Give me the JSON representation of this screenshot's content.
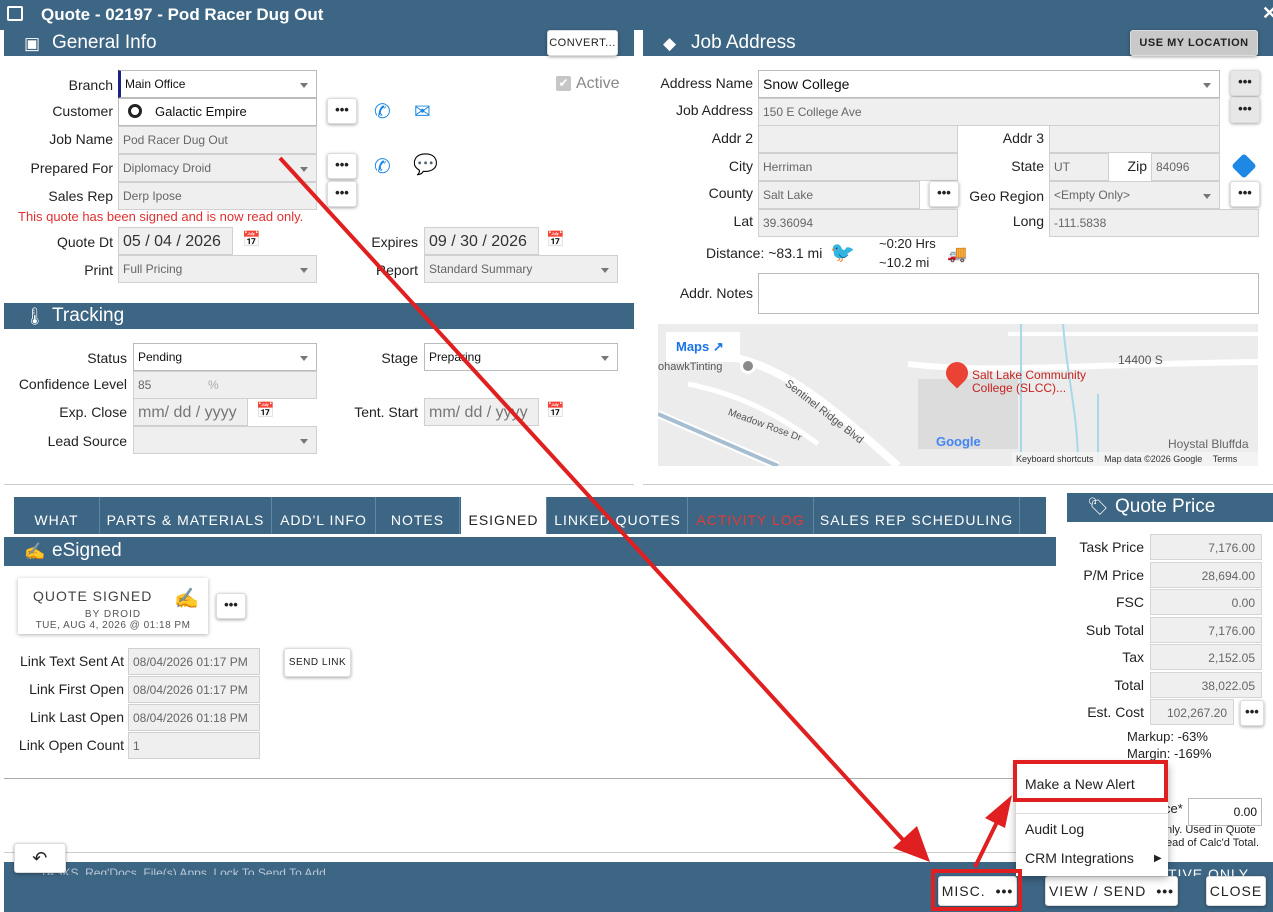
{
  "title": "Quote - 02197 - Pod Racer Dug Out",
  "general": {
    "header": "General Info",
    "convert": "CONVERT...",
    "active": "Active",
    "branch_label": "Branch",
    "branch": "Main Office",
    "customer_label": "Customer",
    "customer": "Galactic Empire",
    "jobname_label": "Job Name",
    "jobname": "Pod Racer Dug Out",
    "preparedfor_label": "Prepared For",
    "preparedfor": "Diplomacy Droid",
    "salesrep_label": "Sales Rep",
    "salesrep": "Derp Ipose",
    "signed_msg": "This quote has been signed and is now read only.",
    "quotedt_label": "Quote Dt",
    "quotedt": "05 / 04 / 2026",
    "expires_label": "Expires",
    "expires": "09 / 30 / 2026",
    "print_label": "Print",
    "print": "Full Pricing",
    "report_label": "Report",
    "report": "Standard Summary"
  },
  "tracking": {
    "header": "Tracking",
    "status_label": "Status",
    "status": "Pending",
    "stage_label": "Stage",
    "stage": "Preparing",
    "confidence_label": "Confidence Level",
    "confidence": "85",
    "pct": "%",
    "expclose_label": "Exp. Close",
    "date_placeholder": "mm/ dd / yyyy",
    "tentstart_label": "Tent. Start",
    "leadsource_label": "Lead Source"
  },
  "job": {
    "header": "Job Address",
    "use_location": "USE MY LOCATION",
    "addrname_label": "Address Name",
    "addrname": "Snow College",
    "jobaddr_label": "Job Address",
    "jobaddr": "150 E College Ave",
    "addr2_label": "Addr 2",
    "addr3_label": "Addr 3",
    "city_label": "City",
    "city": "Herriman",
    "state_label": "State",
    "state": "UT",
    "zip_label": "Zip",
    "zip": "84096",
    "county_label": "County",
    "county": "Salt Lake",
    "georegion_label": "Geo Region",
    "georegion": "<Empty Only>",
    "lat_label": "Lat",
    "lat": "39.36094",
    "long_label": "Long",
    "long": "-111.5838",
    "distance": "Distance: ~83.1 mi",
    "drive_hrs": "~0:20 Hrs",
    "drive_mi": "~10.2 mi",
    "notes_label": "Addr. Notes"
  },
  "map": {
    "maps_link": "Maps",
    "tinting": "ohawkTinting",
    "street1": "Sentinel Ridge Blvd",
    "street2": "Meadow Rose Dr",
    "road": "14400 S",
    "place1": "Salt Lake Community",
    "place2": "College (SLCC)...",
    "place3": "Hoystal Bluffda",
    "google": "Google",
    "footer1": "Keyboard shortcuts",
    "footer2": "Map data ©2026 Google",
    "footer3": "Terms"
  },
  "tabs": [
    "WHAT",
    "PARTS & MATERIALS",
    "ADD'L INFO",
    "NOTES",
    "ESIGNED",
    "LINKED QUOTES",
    "ACTIVITY LOG",
    "SALES REP SCHEDULING"
  ],
  "esigned": {
    "header": "eSigned",
    "card_title": "QUOTE SIGNED",
    "card_by": "BY DROID",
    "card_date": "TUE, AUG 4, 2026 @ 01:18 PM",
    "send_link": "SEND LINK",
    "rows": [
      {
        "label": "Link Text Sent At",
        "value": "08/04/2026 01:17 PM"
      },
      {
        "label": "Link First Open",
        "value": "08/04/2026 01:17 PM"
      },
      {
        "label": "Link Last Open",
        "value": "08/04/2026 01:18 PM"
      },
      {
        "label": "Link Open Count",
        "value": "1"
      }
    ]
  },
  "price": {
    "header": "Quote Price",
    "rows": [
      {
        "label": "Task Price",
        "value": "7,176.00"
      },
      {
        "label": "P/M Price",
        "value": "28,694.00"
      },
      {
        "label": "FSC",
        "value": "0.00"
      },
      {
        "label": "Sub Total",
        "value": "7,176.00"
      },
      {
        "label": "Tax",
        "value": "2,152.05"
      },
      {
        "label": "Total",
        "value": "38,022.05"
      },
      {
        "label": "Est. Cost",
        "value": "102,267.20"
      }
    ],
    "markup": "Markup: -63%",
    "margin": "Margin: -169%",
    "ce_frag": "ce*",
    "ce_value": "0.00",
    "note1": "nly. Used in Quote",
    "note2": "ead of Calc'd Total."
  },
  "menu": {
    "items": [
      "Make a New Alert",
      "Audit Log",
      "CRM Integrations"
    ]
  },
  "footer": {
    "obscured": "TASKS, Req'Docs, File(s) Apps, Lock To Send To Add",
    "active_only": "TIVE ONLY",
    "misc": "MISC.",
    "view_send": "VIEW / SEND",
    "close": "CLOSE"
  },
  "colors": {
    "header": "#3d6584",
    "annotation": "#e02020",
    "link": "#1e88e5",
    "error": "#e03030"
  }
}
